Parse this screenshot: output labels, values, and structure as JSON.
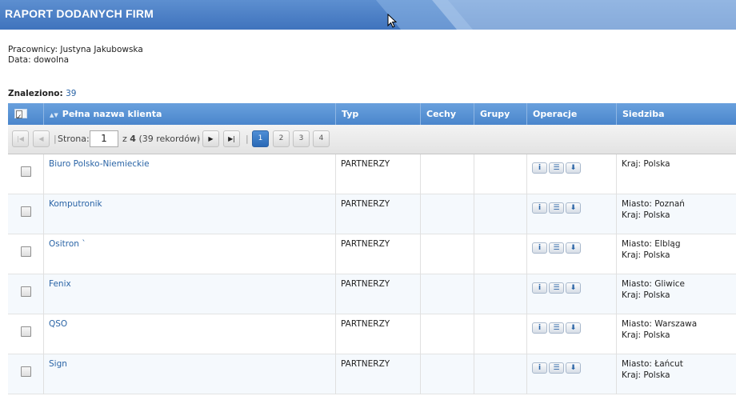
{
  "header": {
    "title": "RAPORT DODANYCH FIRM"
  },
  "info": {
    "employees": "Pracownicy: Justyna Jakubowska",
    "date": "Data: dowolna"
  },
  "found": {
    "label": "Znaleziono:",
    "count": "39"
  },
  "columns": {
    "name": "Pełna nazwa klienta",
    "type": "Typ",
    "features": "Cechy",
    "groups": "Grupy",
    "operations": "Operacje",
    "seat": "Siedziba"
  },
  "pager": {
    "page_label": "Strona:",
    "current": "1",
    "of_prefix": "z",
    "total_pages": "4",
    "records": "(39 rekordów)",
    "pages": [
      "1",
      "2",
      "3",
      "4"
    ]
  },
  "rows": [
    {
      "name": "Biuro Polsko-Niemieckie",
      "type": "PARTNERZY",
      "city": "",
      "country": "Kraj: Polska"
    },
    {
      "name": "Komputronik",
      "type": "PARTNERZY",
      "city": "Miasto: Poznań",
      "country": "Kraj: Polska"
    },
    {
      "name": "Ositron `",
      "type": "PARTNERZY",
      "city": "Miasto: Elbląg",
      "country": "Kraj: Polska"
    },
    {
      "name": "Fenix",
      "type": "PARTNERZY",
      "city": "Miasto: Gliwice",
      "country": "Kraj: Polska"
    },
    {
      "name": "QSO",
      "type": "PARTNERZY",
      "city": "Miasto: Warszawa",
      "country": "Kraj: Polska"
    },
    {
      "name": "Sign",
      "type": "PARTNERZY",
      "city": "Miasto: Łańcut",
      "country": "Kraj: Polska"
    }
  ],
  "icons": {
    "info": "info-icon",
    "list": "list-icon",
    "download": "download-icon"
  },
  "colors": {
    "header": "#4a7fc6",
    "link": "#2a64a6",
    "active_page": "#3a7bc8"
  }
}
